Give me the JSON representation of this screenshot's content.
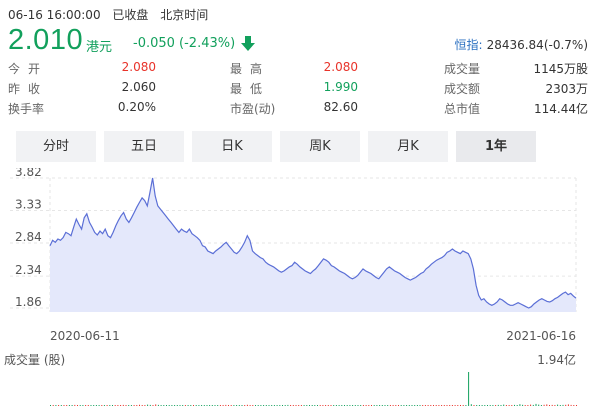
{
  "header": {
    "datetime": "06-16 16:00:00",
    "status": "已收盘",
    "timezone": "北京时间"
  },
  "quote": {
    "price": "2.010",
    "currency": "港元",
    "change": "-0.050 (-2.43%)",
    "direction_icon": "down-arrow-icon",
    "color": "#12a05c"
  },
  "index": {
    "name": "恒指:",
    "value": "28436.84(-0.7%)"
  },
  "stats": {
    "rows": [
      [
        {
          "label": "今开",
          "value": "2.080",
          "tone": "red"
        },
        {
          "label": "最高",
          "value": "2.080",
          "tone": "red"
        },
        {
          "label": "成交量",
          "value": "1145万股",
          "tone": ""
        }
      ],
      [
        {
          "label": "昨收",
          "value": "2.060",
          "tone": ""
        },
        {
          "label": "最低",
          "value": "1.990",
          "tone": "green"
        },
        {
          "label": "成交额",
          "value": "2303万",
          "tone": ""
        }
      ],
      [
        {
          "label": "换手率",
          "value": "0.20%",
          "tone": ""
        },
        {
          "label": "市盈(动)",
          "value": "82.60",
          "tone": ""
        },
        {
          "label": "总市值",
          "value": "114.44亿",
          "tone": ""
        }
      ]
    ]
  },
  "tabs": [
    {
      "label": "分时",
      "active": false
    },
    {
      "label": "五日",
      "active": false
    },
    {
      "label": "日K",
      "active": false
    },
    {
      "label": "周K",
      "active": false
    },
    {
      "label": "月K",
      "active": false
    },
    {
      "label": "1年",
      "active": true
    }
  ],
  "chart_data": {
    "type": "area",
    "y_ticks": [
      "3.82",
      "3.33",
      "2.84",
      "2.34",
      "1.86"
    ],
    "ylim": [
      1.86,
      3.82
    ],
    "x_tick_labels": [
      "2020-06-11",
      "2021-06-16"
    ],
    "series": [
      {
        "values": [
          2.8,
          2.88,
          2.85,
          2.9,
          2.88,
          2.92,
          3.0,
          2.98,
          2.95,
          3.08,
          3.2,
          3.12,
          3.05,
          3.22,
          3.28,
          3.15,
          3.08,
          3.0,
          2.96,
          3.02,
          2.98,
          3.05,
          2.95,
          2.92,
          3.0,
          3.1,
          3.18,
          3.25,
          3.3,
          3.2,
          3.15,
          3.22,
          3.3,
          3.38,
          3.45,
          3.52,
          3.48,
          3.4,
          3.6,
          3.82,
          3.55,
          3.4,
          3.35,
          3.3,
          3.25,
          3.2,
          3.15,
          3.1,
          3.05,
          3.0,
          3.05,
          3.02,
          3.0,
          3.05,
          2.98,
          2.95,
          2.92,
          2.88,
          2.8,
          2.78,
          2.72,
          2.7,
          2.68,
          2.72,
          2.75,
          2.78,
          2.82,
          2.85,
          2.8,
          2.75,
          2.7,
          2.68,
          2.72,
          2.78,
          2.85,
          2.95,
          2.88,
          2.72,
          2.68,
          2.65,
          2.62,
          2.6,
          2.55,
          2.52,
          2.5,
          2.48,
          2.45,
          2.42,
          2.4,
          2.42,
          2.45,
          2.48,
          2.5,
          2.55,
          2.52,
          2.48,
          2.45,
          2.42,
          2.4,
          2.38,
          2.42,
          2.45,
          2.5,
          2.55,
          2.6,
          2.58,
          2.55,
          2.5,
          2.48,
          2.45,
          2.42,
          2.4,
          2.38,
          2.35,
          2.32,
          2.3,
          2.32,
          2.35,
          2.4,
          2.45,
          2.42,
          2.4,
          2.38,
          2.35,
          2.32,
          2.3,
          2.35,
          2.4,
          2.45,
          2.48,
          2.45,
          2.42,
          2.4,
          2.38,
          2.35,
          2.32,
          2.3,
          2.28,
          2.3,
          2.32,
          2.35,
          2.38,
          2.4,
          2.45,
          2.48,
          2.52,
          2.55,
          2.58,
          2.6,
          2.62,
          2.65,
          2.7,
          2.72,
          2.75,
          2.72,
          2.7,
          2.68,
          2.72,
          2.7,
          2.68,
          2.6,
          2.45,
          2.2,
          2.05,
          1.98,
          2.0,
          1.95,
          1.92,
          1.9,
          1.92,
          1.95,
          2.0,
          1.98,
          1.95,
          1.92,
          1.9,
          1.9,
          1.92,
          1.94,
          1.92,
          1.9,
          1.88,
          1.86,
          1.88,
          1.92,
          1.95,
          1.98,
          2.0,
          1.98,
          1.96,
          1.95,
          1.97,
          2.0,
          2.02,
          2.05,
          2.08,
          2.1,
          2.06,
          2.08,
          2.04,
          2.01
        ]
      }
    ],
    "color": "#5b6fd6",
    "fill_color": "#e4e8fb"
  },
  "volume": {
    "label": "成交量 (股)",
    "max_label": "1.94亿",
    "values": [
      0.02,
      0.03,
      0.02,
      0.01,
      0.05,
      0.02,
      0.04,
      0.03,
      0.02,
      0.06,
      0.03,
      0.02,
      0.04,
      0.02,
      0.03,
      0.05,
      0.02,
      0.03,
      0.04,
      0.02,
      0.01,
      0.03,
      0.02,
      0.05,
      0.03,
      0.02,
      0.04,
      0.06,
      0.03,
      0.02,
      0.05,
      0.03,
      0.04,
      0.07,
      0.05,
      0.04,
      0.08,
      0.06,
      0.05,
      0.09,
      0.06,
      0.04,
      0.03,
      0.05,
      0.02,
      0.03,
      0.04,
      0.02,
      0.03,
      0.05,
      0.03,
      0.02,
      0.04,
      0.03,
      0.02,
      0.05,
      0.03,
      0.04,
      0.02,
      0.03,
      0.05,
      0.02,
      0.04,
      0.03,
      0.02,
      0.06,
      0.03,
      0.05,
      0.02,
      0.04,
      0.03,
      0.02,
      0.05,
      0.07,
      0.03,
      0.04,
      0.02,
      0.03,
      0.05,
      0.02,
      0.04,
      0.03,
      0.02,
      0.05,
      0.03,
      0.04,
      0.02,
      0.03,
      0.06,
      0.02,
      0.04,
      0.03,
      0.02,
      0.05,
      0.03,
      0.02,
      0.04,
      0.03,
      0.02,
      0.05,
      0.03,
      0.04,
      0.02,
      0.03,
      0.05,
      0.04,
      0.03,
      0.02,
      0.04,
      0.03,
      0.05,
      0.02,
      0.04,
      0.03,
      0.02,
      0.05,
      0.03,
      0.04,
      0.02,
      0.03,
      0.05,
      0.03,
      0.04,
      0.02,
      0.03,
      0.05,
      0.02,
      0.04,
      0.03,
      0.02,
      0.05,
      0.03,
      0.04,
      0.02,
      0.03,
      0.05,
      0.04,
      0.03,
      0.02,
      0.04,
      0.03,
      0.05,
      0.02,
      0.04,
      0.03,
      0.02,
      0.05,
      0.03,
      0.04,
      0.02,
      0.03,
      0.05,
      0.03,
      0.04,
      0.02,
      1.94,
      0.1,
      0.05,
      0.03,
      0.04,
      0.02,
      0.03,
      0.05,
      0.02,
      0.04,
      0.03,
      0.06,
      0.04,
      0.08,
      0.05,
      0.03,
      0.04,
      0.06,
      0.05,
      0.1,
      0.07,
      0.04,
      0.05,
      0.08,
      0.06,
      0.12,
      0.08,
      0.05,
      0.07,
      0.09,
      0.05,
      0.06,
      0.04,
      0.08,
      0.05,
      0.06,
      0.07,
      0.09,
      0.06,
      0.04,
      0.05
    ],
    "up_color": "#e8332a",
    "down_color": "#12a05c"
  }
}
